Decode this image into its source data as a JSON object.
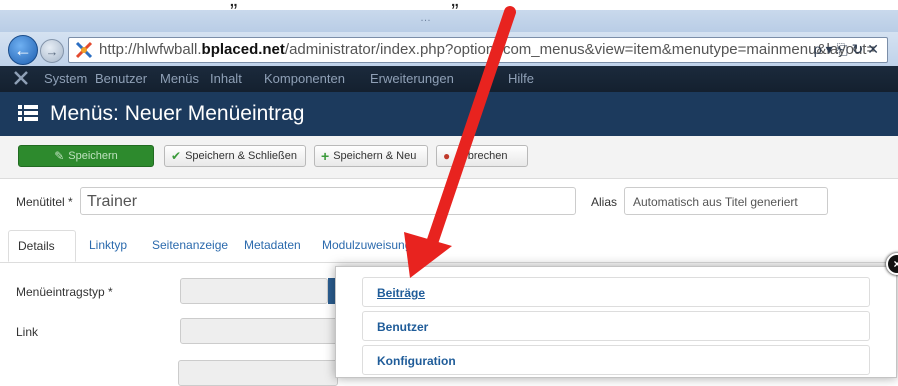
{
  "caption": {
    "text": "„                                   „"
  },
  "browser": {
    "window_title": "…",
    "url_plain": "http://hlwfwball.",
    "url_domain": "bplaced.net",
    "url_rest": "/administrator/index.php?option=com_menus&view=item&menutype=mainmenu&layout=",
    "url_controls": "ρ ▾ ⎗ ↻ ✕"
  },
  "topmenu": {
    "items": [
      "System",
      "Benutzer",
      "Menüs",
      "Inhalt",
      "Komponenten",
      "Erweiterungen",
      "Hilfe"
    ]
  },
  "header": {
    "title": "Menüs: Neuer Menüeintrag"
  },
  "toolbar": {
    "save": "Speichern",
    "save_close": "Speichern & Schließen",
    "save_new": "Speichern & Neu",
    "cancel": "Abbrechen"
  },
  "form": {
    "title_label": "Menütitel *",
    "title_value": "Trainer",
    "alias_label": "Alias",
    "alias_placeholder": "Automatisch aus Titel generiert",
    "type_label": "Menüeintragstyp *",
    "link_label": "Link"
  },
  "tabs": [
    "Details",
    "Linktyp",
    "Seitenanzeige",
    "Metadaten",
    "Modulzuweisung"
  ],
  "modal": {
    "items": [
      "Beiträge",
      "Benutzer",
      "Konfiguration"
    ],
    "close": "×"
  },
  "colors": {
    "header": "#1c3a5d",
    "topmenu": "#16222f",
    "save_button": "#2d8a2d",
    "arrow": "#e8231f",
    "link": "#1f5c99"
  }
}
